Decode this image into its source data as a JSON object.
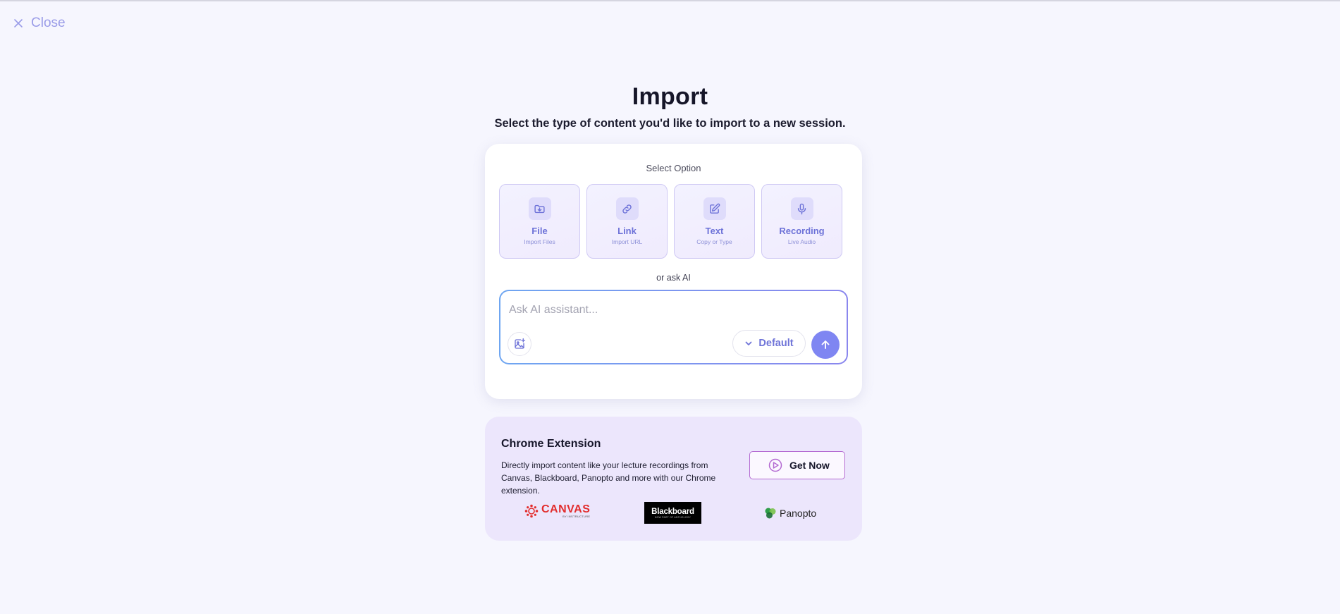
{
  "header": {
    "close_label": "Close"
  },
  "page": {
    "title": "Import",
    "subtitle": "Select the type of content you'd like to import to a new session."
  },
  "import_card": {
    "select_label": "Select Option",
    "options": [
      {
        "label": "File",
        "sub": "Import Files",
        "icon": "folder-download-icon"
      },
      {
        "label": "Link",
        "sub": "Import URL",
        "icon": "link-icon"
      },
      {
        "label": "Text",
        "sub": "Copy or Type",
        "icon": "edit-icon"
      },
      {
        "label": "Recording",
        "sub": "Live Audio",
        "icon": "microphone-icon"
      }
    ],
    "or_ask_label": "or ask AI",
    "ai_placeholder": "Ask AI assistant...",
    "model_label": "Default"
  },
  "extension": {
    "title": "Chrome Extension",
    "description": "Directly import content like your lecture recordings from Canvas, Blackboard, Panopto and more with our Chrome extension.",
    "button_label": "Get Now",
    "logos": {
      "canvas": "CANVAS",
      "canvas_tag": "BY INSTRUCTURE",
      "blackboard": "Blackboard",
      "blackboard_tag": "NOW PART OF ANTHOLOGY",
      "panopto": "Panopto"
    }
  },
  "colors": {
    "accent": "#7f86f2",
    "option_text": "#6d72d8",
    "background": "#f6f6fe"
  }
}
